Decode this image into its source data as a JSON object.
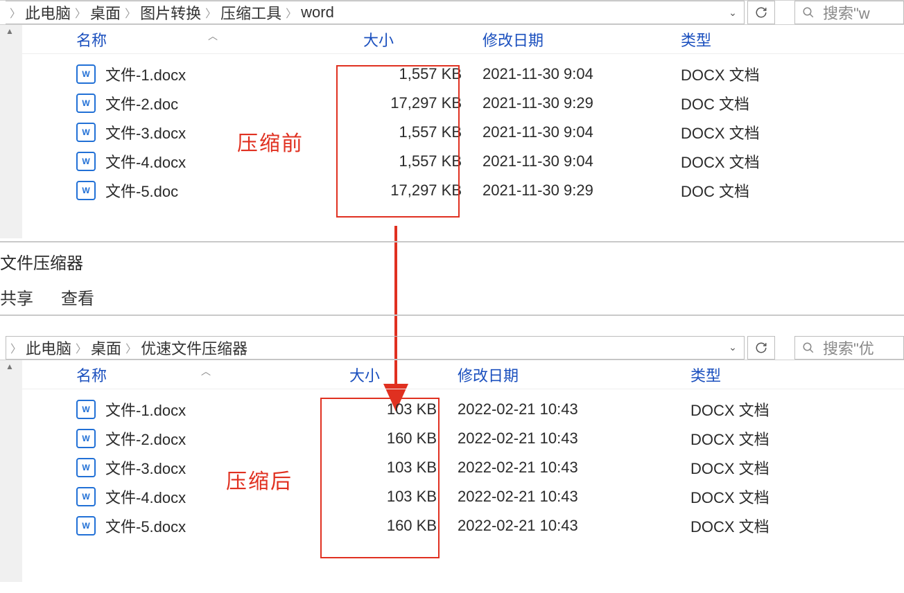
{
  "panel_before": {
    "breadcrumb": [
      "此电脑",
      "桌面",
      "图片转换",
      "压缩工具",
      "word"
    ],
    "search_placeholder": "搜索\"w",
    "columns": {
      "name": "名称",
      "size": "大小",
      "date": "修改日期",
      "type": "类型"
    },
    "rows": [
      {
        "name": "文件-1.docx",
        "size": "1,557 KB",
        "date": "2021-11-30 9:04",
        "type": "DOCX 文档"
      },
      {
        "name": "文件-2.doc",
        "size": "17,297 KB",
        "date": "2021-11-30 9:29",
        "type": "DOC 文档"
      },
      {
        "name": "文件-3.docx",
        "size": "1,557 KB",
        "date": "2021-11-30 9:04",
        "type": "DOCX 文档"
      },
      {
        "name": "文件-4.docx",
        "size": "1,557 KB",
        "date": "2021-11-30 9:04",
        "type": "DOCX 文档"
      },
      {
        "name": "文件-5.doc",
        "size": "17,297 KB",
        "date": "2021-11-30 9:29",
        "type": "DOC 文档"
      }
    ],
    "annotation": "压缩前"
  },
  "panel_after": {
    "window_title": "文件压缩器",
    "ribbon": [
      "共享",
      "查看"
    ],
    "breadcrumb": [
      "此电脑",
      "桌面",
      "优速文件压缩器"
    ],
    "search_placeholder": "搜索\"优",
    "columns": {
      "name": "名称",
      "size": "大小",
      "date": "修改日期",
      "type": "类型"
    },
    "rows": [
      {
        "name": "文件-1.docx",
        "size": "103 KB",
        "date": "2022-02-21 10:43",
        "type": "DOCX 文档"
      },
      {
        "name": "文件-2.docx",
        "size": "160 KB",
        "date": "2022-02-21 10:43",
        "type": "DOCX 文档"
      },
      {
        "name": "文件-3.docx",
        "size": "103 KB",
        "date": "2022-02-21 10:43",
        "type": "DOCX 文档"
      },
      {
        "name": "文件-4.docx",
        "size": "103 KB",
        "date": "2022-02-21 10:43",
        "type": "DOCX 文档"
      },
      {
        "name": "文件-5.docx",
        "size": "160 KB",
        "date": "2022-02-21 10:43",
        "type": "DOCX 文档"
      }
    ],
    "annotation": "压缩后"
  }
}
